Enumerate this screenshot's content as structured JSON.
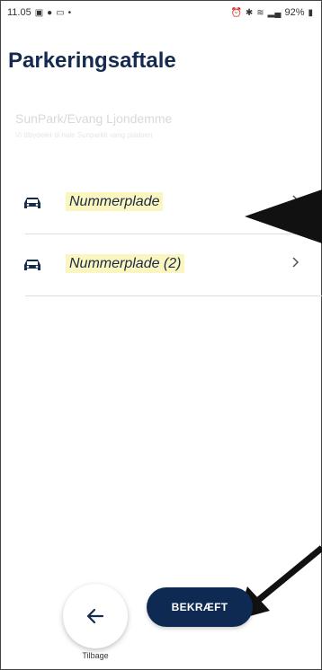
{
  "status_bar": {
    "time": "11.05",
    "battery": "92%"
  },
  "page": {
    "title": "Parkeringsaftale",
    "subtitle": "SunPark/Evang Ljondemme",
    "subtitle_detail": "Vi tilbydeler til hale Sunparkit vang pladsen"
  },
  "plates": [
    {
      "label": "Nummerplade"
    },
    {
      "label": "Nummerplade (2)"
    }
  ],
  "footer": {
    "back_label": "Tilbage",
    "confirm_label": "BEKRÆFT"
  },
  "colors": {
    "primary": "#0f2a52",
    "title": "#142a4f",
    "highlight": "#fbf6bf"
  },
  "icons": {
    "plate_row": "car-icon",
    "row_arrow": "chevron-right-icon",
    "back": "arrow-left-icon"
  }
}
